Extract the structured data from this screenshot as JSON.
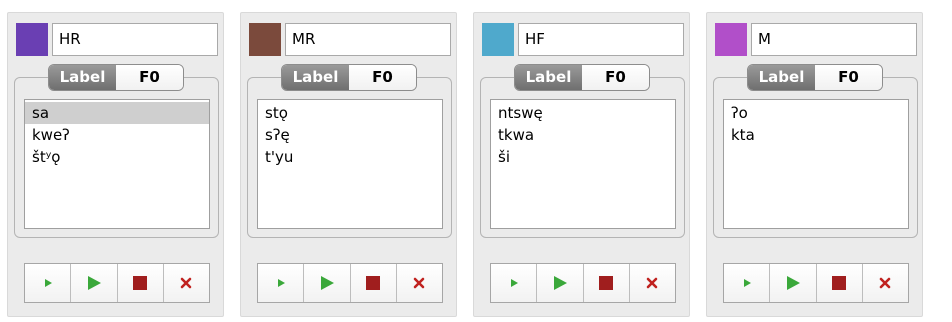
{
  "segment_labels": [
    "Label",
    "F0"
  ],
  "colors": {
    "play_green": "#3aa83a",
    "stop_red": "#a01e1e",
    "close_red": "#c0221f",
    "selected_row": "#cfcfcf"
  },
  "panels": [
    {
      "name": "HR",
      "color": "#6a3fb3",
      "active_tab": "Label",
      "items": [
        "sa",
        "kweʔ",
        "štʸǫ"
      ],
      "selected_index": 0
    },
    {
      "name": "MR",
      "color": "#7b4a3c",
      "active_tab": "Label",
      "items": [
        "stǫ",
        "sʔę",
        "t'yu"
      ],
      "selected_index": -1
    },
    {
      "name": "HF",
      "color": "#4fa9cc",
      "active_tab": "Label",
      "items": [
        "ntswę",
        "tkwa",
        "ši"
      ],
      "selected_index": -1
    },
    {
      "name": "M",
      "color": "#b14fc9",
      "active_tab": "Label",
      "items": [
        "ʔo",
        "kta"
      ],
      "selected_index": -1
    }
  ],
  "transport_icons": [
    "play-small-icon",
    "play-icon",
    "stop-icon",
    "close-icon"
  ]
}
